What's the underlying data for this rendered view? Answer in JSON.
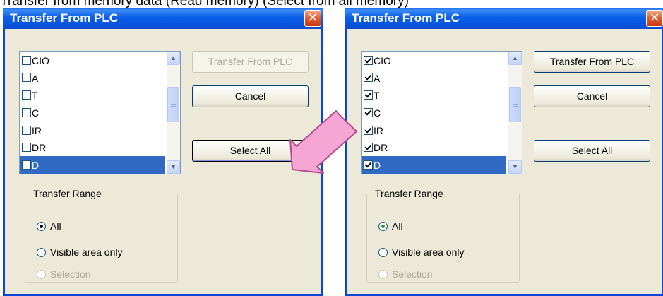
{
  "caption": {
    "text": "Transfer from memory data (Read memory) (Select from all memory)"
  },
  "colors": {
    "title_bar": "#0a5fe9",
    "selection": "#316ac5",
    "dialog_bg": "#ece9d8",
    "annotation_arrow": "#f5a6d4"
  },
  "dialogs": [
    {
      "id": "left",
      "title": "Transfer From PLC",
      "close_label": "✕",
      "list_items": [
        {
          "label": "CIO",
          "checked": false,
          "selected": false
        },
        {
          "label": "A",
          "checked": false,
          "selected": false
        },
        {
          "label": "T",
          "checked": false,
          "selected": false
        },
        {
          "label": "C",
          "checked": false,
          "selected": false
        },
        {
          "label": "IR",
          "checked": false,
          "selected": false
        },
        {
          "label": "DR",
          "checked": false,
          "selected": false
        },
        {
          "label": "D",
          "checked": false,
          "selected": true
        }
      ],
      "buttons": {
        "transfer": {
          "label": "Transfer From PLC",
          "enabled": false
        },
        "cancel": {
          "label": "Cancel",
          "enabled": true
        },
        "select_all": {
          "label": "Select All",
          "enabled": true,
          "focused": true
        }
      },
      "transfer_range": {
        "legend": "Transfer Range",
        "options": [
          {
            "label": "All",
            "selected": true,
            "enabled": true
          },
          {
            "label": "Visible area only",
            "selected": false,
            "enabled": true
          },
          {
            "label": "Selection",
            "selected": false,
            "enabled": false
          }
        ]
      }
    },
    {
      "id": "right",
      "title": "Transfer From PLC",
      "close_label": "✕",
      "list_items": [
        {
          "label": "CIO",
          "checked": true,
          "selected": false
        },
        {
          "label": "A",
          "checked": true,
          "selected": false
        },
        {
          "label": "T",
          "checked": true,
          "selected": false
        },
        {
          "label": "C",
          "checked": true,
          "selected": false
        },
        {
          "label": "IR",
          "checked": true,
          "selected": false
        },
        {
          "label": "DR",
          "checked": true,
          "selected": false
        },
        {
          "label": "D",
          "checked": true,
          "selected": true
        }
      ],
      "buttons": {
        "transfer": {
          "label": "Transfer From PLC",
          "enabled": true
        },
        "cancel": {
          "label": "Cancel",
          "enabled": true
        },
        "select_all": {
          "label": "Select All",
          "enabled": true,
          "focused": false
        }
      },
      "transfer_range": {
        "legend": "Transfer Range",
        "options": [
          {
            "label": "All",
            "selected": true,
            "enabled": true
          },
          {
            "label": "Visible area only",
            "selected": false,
            "enabled": true
          },
          {
            "label": "Selection",
            "selected": false,
            "enabled": false
          }
        ]
      }
    }
  ]
}
